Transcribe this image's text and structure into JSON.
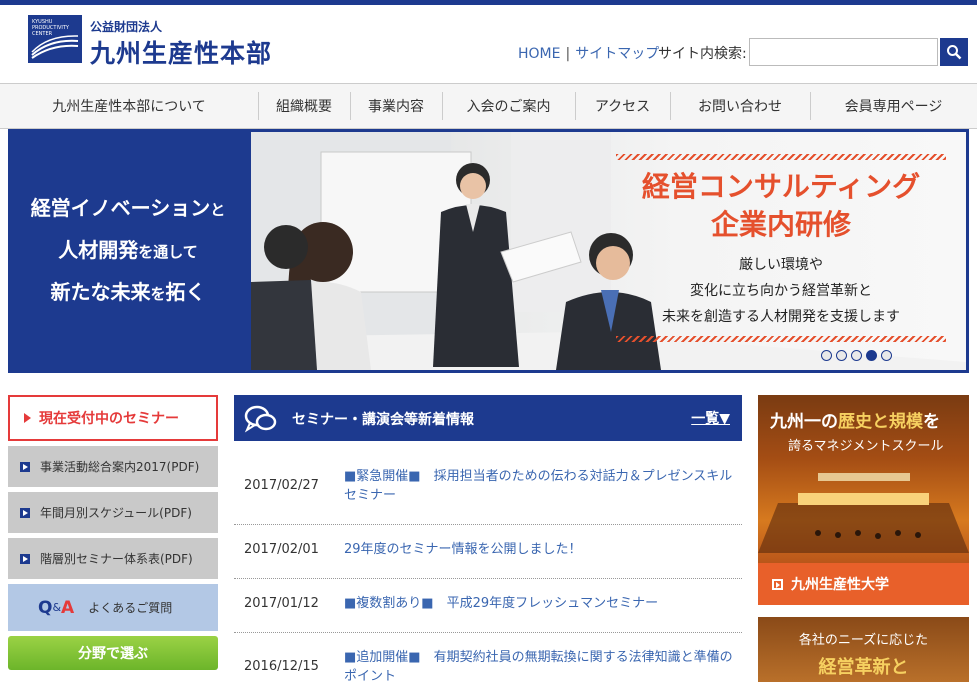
{
  "header": {
    "logo_mark_text": "KYUSHU PRODUCTIVITY CENTER",
    "logo_sub": "公益財団法人",
    "logo_main": "九州生産性本部",
    "links": {
      "home": "HOME",
      "sep": "|",
      "sitemap": "サイトマップ"
    },
    "search_label": "サイト内検索:",
    "search_placeholder": ""
  },
  "nav": {
    "items": [
      {
        "label": "九州生産性本部について"
      },
      {
        "label": "組織概要"
      },
      {
        "label": "事業内容"
      },
      {
        "label": "入会のご案内"
      },
      {
        "label": "アクセス"
      },
      {
        "label": "お問い合わせ"
      },
      {
        "label": "会員専用ページ"
      }
    ]
  },
  "hero": {
    "line1a": "経営イノベーション",
    "line1b": "と",
    "line2a": "人材開発",
    "line2b": "を通して",
    "line3a": "新たな未来",
    "line3b": "を",
    "line3c": "拓く",
    "title1": "経営コンサルティング",
    "title2": "企業内研修",
    "text1": "厳しい環境や",
    "text2": "変化に立ち向かう経営革新と",
    "text3": "未来を創造する人材開発を支援します",
    "slides": 5,
    "active_slide": 4
  },
  "sidebar": {
    "seminar_now": "現在受付中のセミナー",
    "items": [
      {
        "label": "事業活動総合案内2017(PDF)"
      },
      {
        "label": "年間月別スケジュール(PDF)"
      },
      {
        "label": "階層別セミナー体系表(PDF)"
      }
    ],
    "qa_q": "Q",
    "qa_amp": "&",
    "qa_a": "A",
    "qa_label": "よくあるご質問",
    "field": "分野で選ぶ"
  },
  "news": {
    "title": "セミナー・講演会等新着情報",
    "more": "一覧▼",
    "rows": [
      {
        "date": "2017/02/27",
        "text": "■緊急開催■　採用担当者のための伝わる対話力＆プレゼンスキルセミナー"
      },
      {
        "date": "2017/02/01",
        "text": "29年度のセミナー情報を公開しました！"
      },
      {
        "date": "2017/01/12",
        "text": "■複数割あり■　平成29年度フレッシュマンセミナー"
      },
      {
        "date": "2016/12/15",
        "text": "■追加開催■　有期契約社員の無期転換に関する法律知識と準備のポイント"
      }
    ]
  },
  "banners": {
    "b1_t1a": "九州一の",
    "b1_t1b": "歴史と規模",
    "b1_t1c": "を",
    "b1_t2": "誇るマネジメントスクール",
    "b1_foot": "九州生産性大学",
    "b2_t1": "各社のニーズに応じた",
    "b2_t2": "経営革新と"
  },
  "colors": {
    "brand": "#1d3a8f",
    "accent_red": "#e53a3a",
    "hero_orange": "#e5502d",
    "green": "#7cc035"
  }
}
